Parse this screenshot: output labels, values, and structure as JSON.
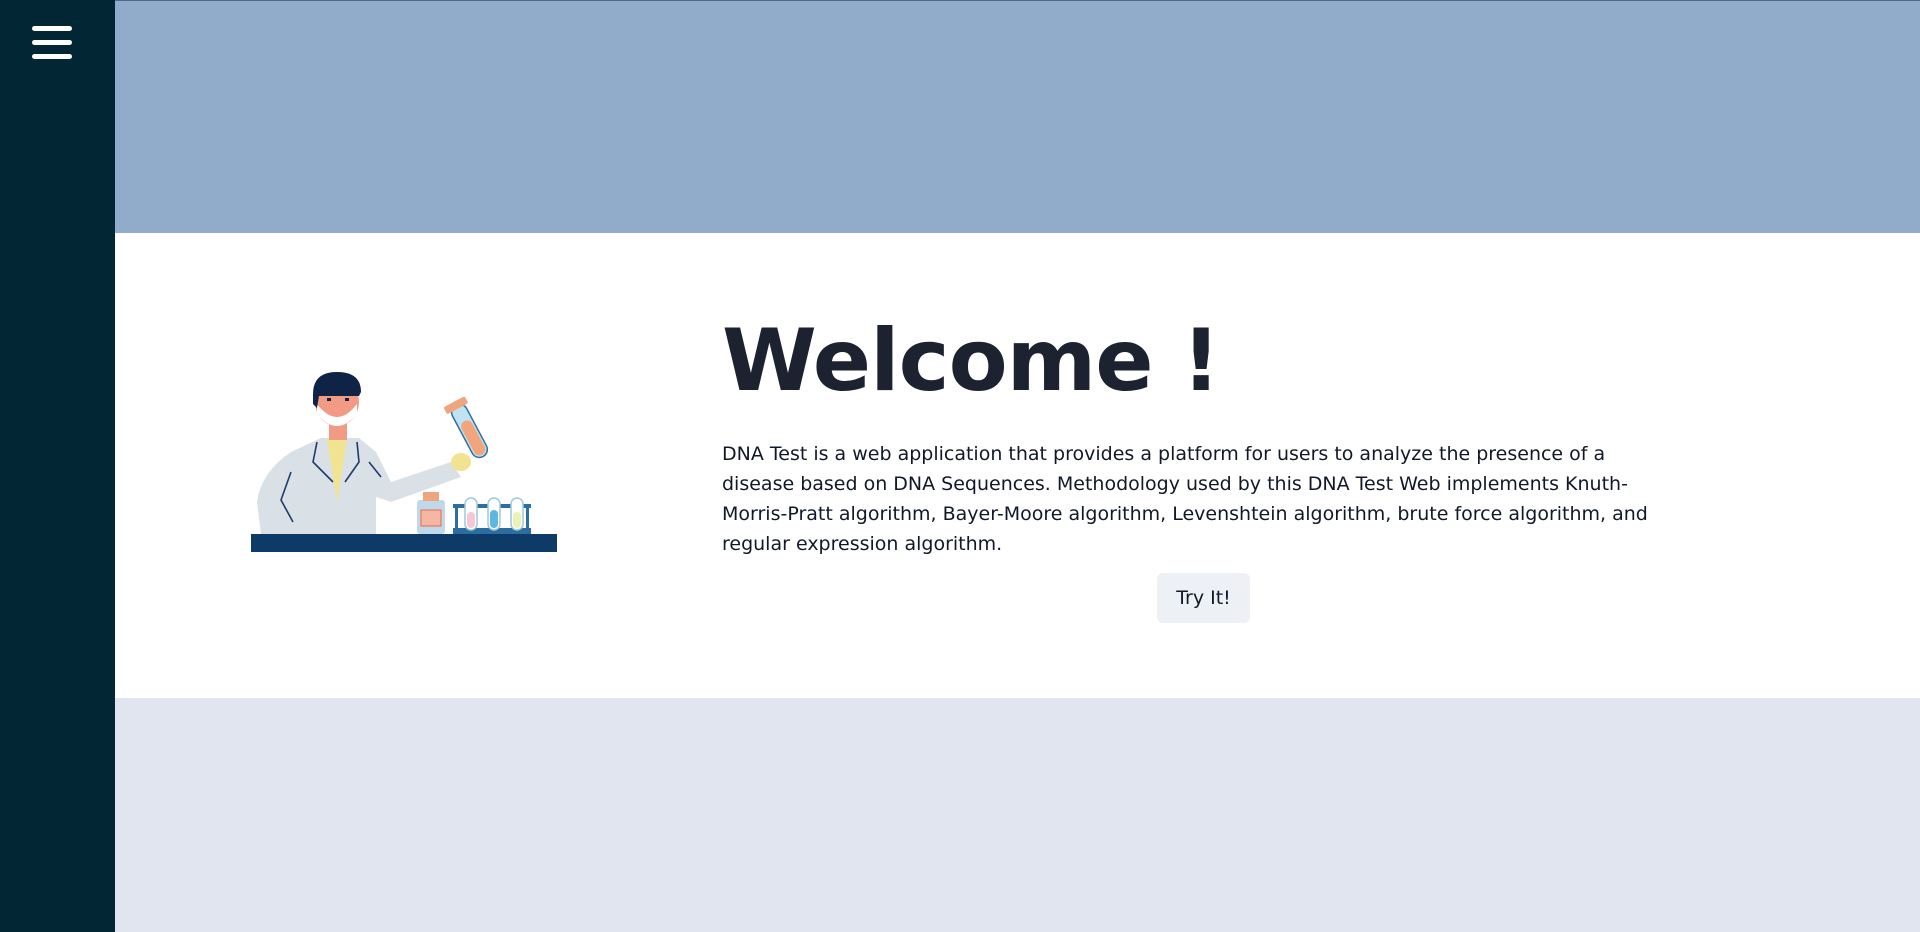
{
  "sidebar": {
    "menu_icon": "hamburger-menu-icon"
  },
  "hero": {
    "title": "Welcome !",
    "description": "DNA Test is a web application that provides a platform for users to analyze the presence of a disease based on DNA Sequences. Methodology used by this DNA Test Web implements Knuth-Morris-Pratt algorithm, Bayer-Moore algorithm, Levenshtein algorithm, brute force algorithm, and regular expression algorithm.",
    "cta_label": "Try It!",
    "illustration": "scientist-with-test-tubes-illustration"
  },
  "colors": {
    "sidebar": "#022634",
    "top_band": "#91abca",
    "bottom_band": "#e0e5f0",
    "title_text": "#1c2230",
    "button_bg": "#edf0f5"
  }
}
